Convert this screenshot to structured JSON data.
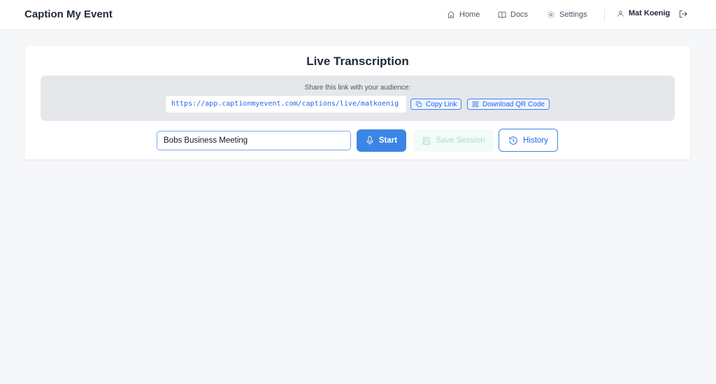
{
  "app": {
    "title": "Caption My Event"
  },
  "nav": {
    "items": [
      {
        "label": "Home",
        "icon": "home-icon"
      },
      {
        "label": "Docs",
        "icon": "book-icon"
      },
      {
        "label": "Settings",
        "icon": "gear-icon"
      }
    ],
    "user_name": "Mat Koenig",
    "user_icon": "user-icon",
    "logout_icon": "logout-icon"
  },
  "main": {
    "title": "Live Transcription",
    "share": {
      "label": "Share this link with your audience:",
      "url": "https://app.captionmyevent.com/captions/live/matkoenig",
      "copy_label": "Copy Link",
      "qr_label": "Download QR Code"
    },
    "session": {
      "name_value": "Bobs Business Meeting",
      "start_label": "Start",
      "save_label": "Save Session",
      "history_label": "History"
    }
  },
  "colors": {
    "accent": "#3b86e4",
    "link": "#2563eb",
    "save_disabled": "#a7e0c6",
    "background": "#f6f7f9"
  }
}
